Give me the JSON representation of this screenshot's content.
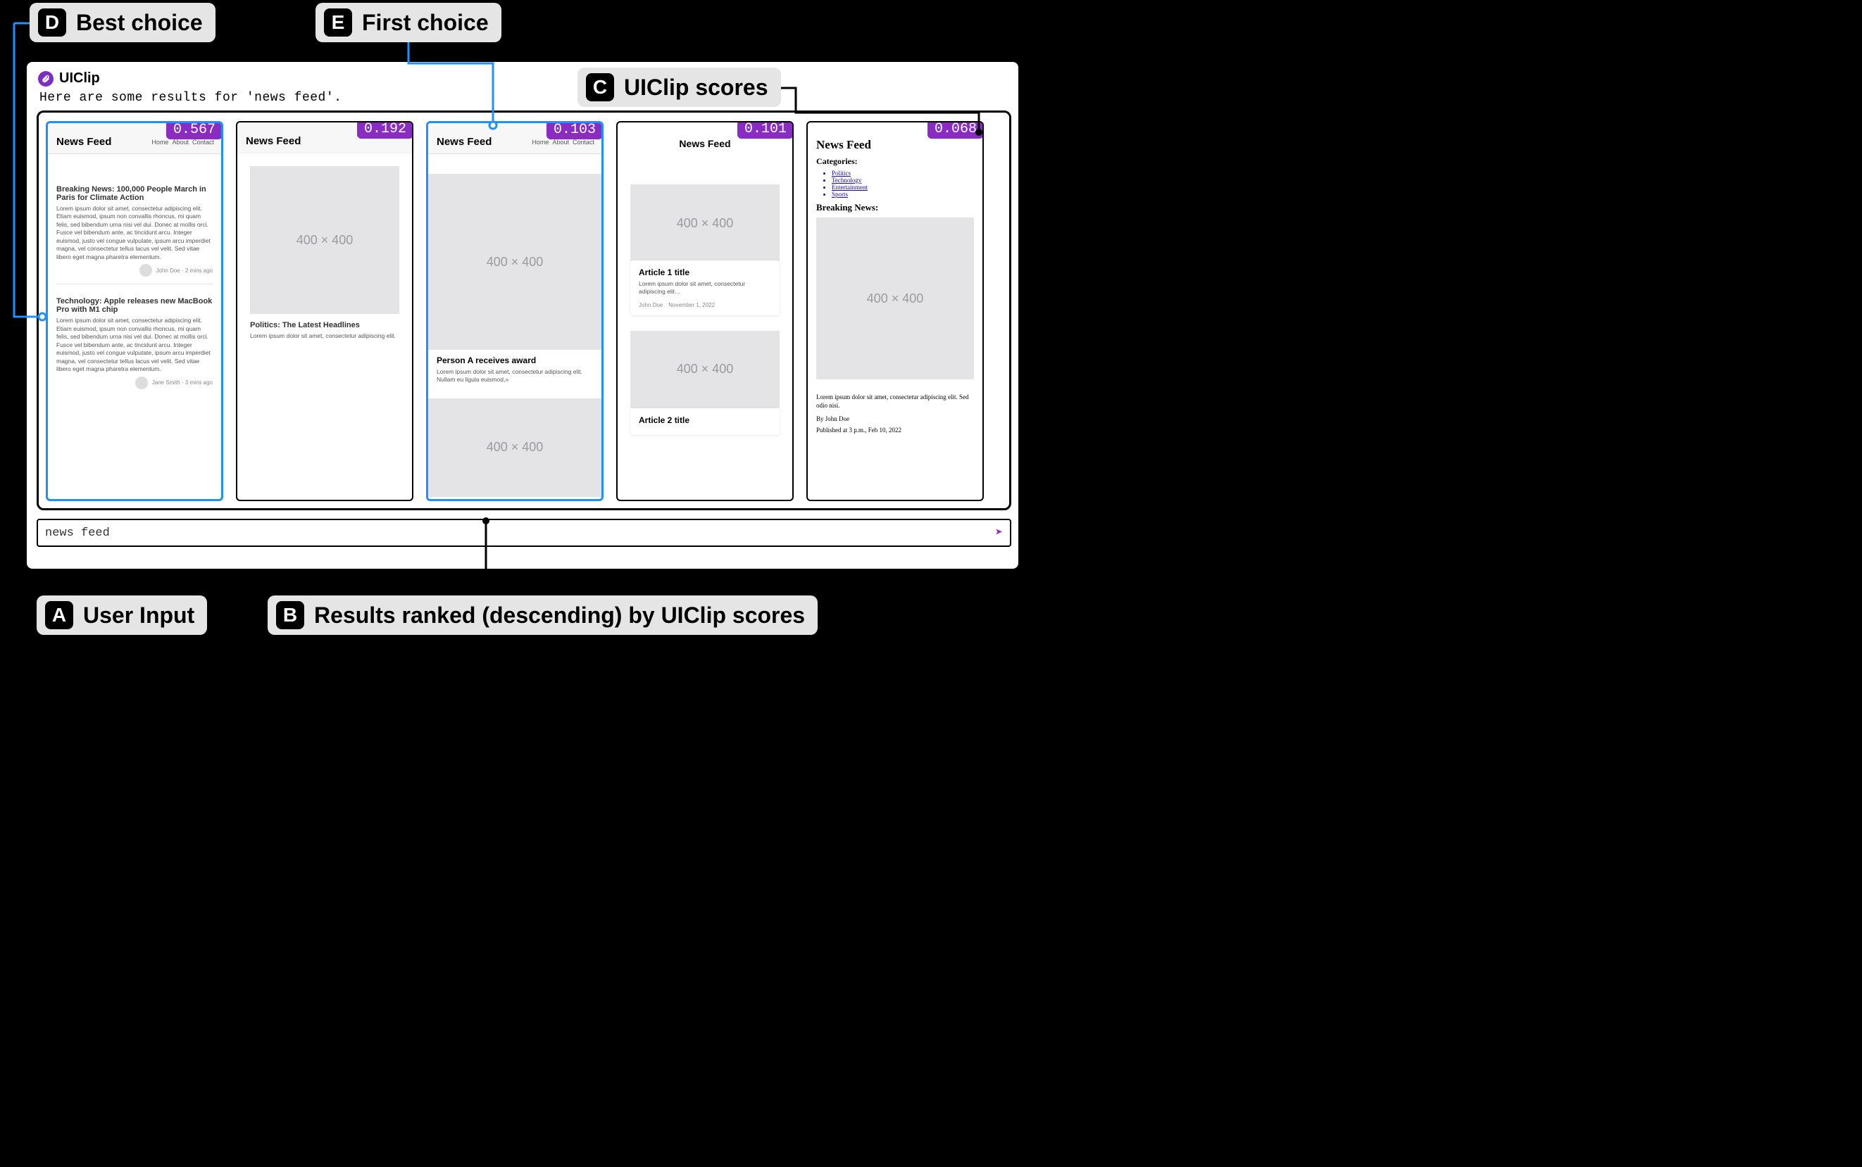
{
  "callouts": {
    "A": "User Input",
    "B": "Results ranked (descending) by UIClip scores",
    "C": "UIClip scores",
    "D": "Best choice",
    "E": "First choice"
  },
  "brand": "UIClip",
  "prompt_text": "Here are some results for 'news feed'.",
  "input_value": "news feed",
  "placeholder_img": "400 × 400",
  "lorem_long": "Lorem ipsum dolor sit amet, consectetur adipiscing elit. Etiam euismod, ipsum non convallis rhoncus, mi quam felis, sed bibendum urna nisi vel dui. Donec at mollis orci. Fusce vel bibendum ante, ac tincidunt arcu. Integer euismod, justo vel congue vulputate, ipsum arcu imperdiet magna, vel consectetur tellus lacus vel velit. Sed vitae libero eget magna pharetra elementum.",
  "lorem_short": "Lorem ipsum dolor sit amet, consectetur adipiscing elit.",
  "lorem_trunc": "Lorem ipsum dolor sit amet, consectetur adipiscing elit…",
  "lorem_award": "Lorem ipsum dolor sit amet, consectetur adipiscing elit. Nullam eu ligula euismod,»",
  "feed_title": "News Feed",
  "nav": {
    "home": "Home",
    "about": "About",
    "contact": "Contact"
  },
  "cards": [
    {
      "score": "0.567",
      "highlight": true,
      "articles": [
        {
          "headline": "Breaking News: 100,000 People March in Paris for Climate Action",
          "byline": "John Doe · 2 mins ago"
        },
        {
          "headline": "Technology: Apple releases new MacBook Pro with M1 chip",
          "byline": "Jane Smith · 3 mins ago"
        }
      ]
    },
    {
      "score": "0.192",
      "article": {
        "headline": "Politics: The Latest Headlines"
      }
    },
    {
      "score": "0.103",
      "highlight": true,
      "article": {
        "headline": "Person A receives award"
      }
    },
    {
      "score": "0.101",
      "articles": [
        {
          "headline": "Article 1 title",
          "author": "John Doe",
          "date": "November 1, 2022"
        },
        {
          "headline": "Article 2 title"
        }
      ]
    },
    {
      "score": "0.068",
      "categories_label": "Categories:",
      "categories": [
        "Politics",
        "Technology",
        "Entertainment",
        "Sports"
      ],
      "breaking_label": "Breaking News:",
      "body": "Lorem ipsum dolor sit amet, consectetur adipiscing elit. Sed odio nisi.",
      "byline": "By John Doe",
      "pub": "Published at 3 p.m., Feb 10, 2022"
    }
  ]
}
